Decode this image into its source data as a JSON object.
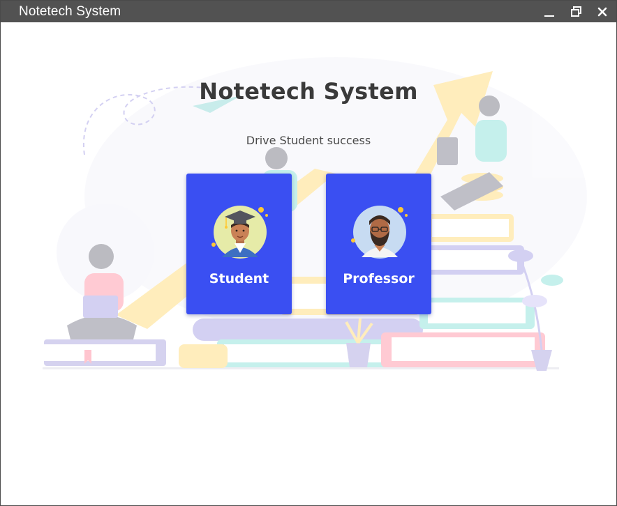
{
  "window": {
    "title": "Notetech System",
    "controls": [
      "minimize-icon",
      "restore-icon",
      "close-icon"
    ]
  },
  "main": {
    "heading": "Notetech System",
    "tagline": "Drive Student success"
  },
  "roles": [
    {
      "label": "Student",
      "icon": "student-avatar-icon"
    },
    {
      "label": "Professor",
      "icon": "professor-avatar-icon"
    }
  ],
  "colors": {
    "titlebar": "#525252",
    "card": "#3a4ff2",
    "heading": "#3a3a3a"
  }
}
